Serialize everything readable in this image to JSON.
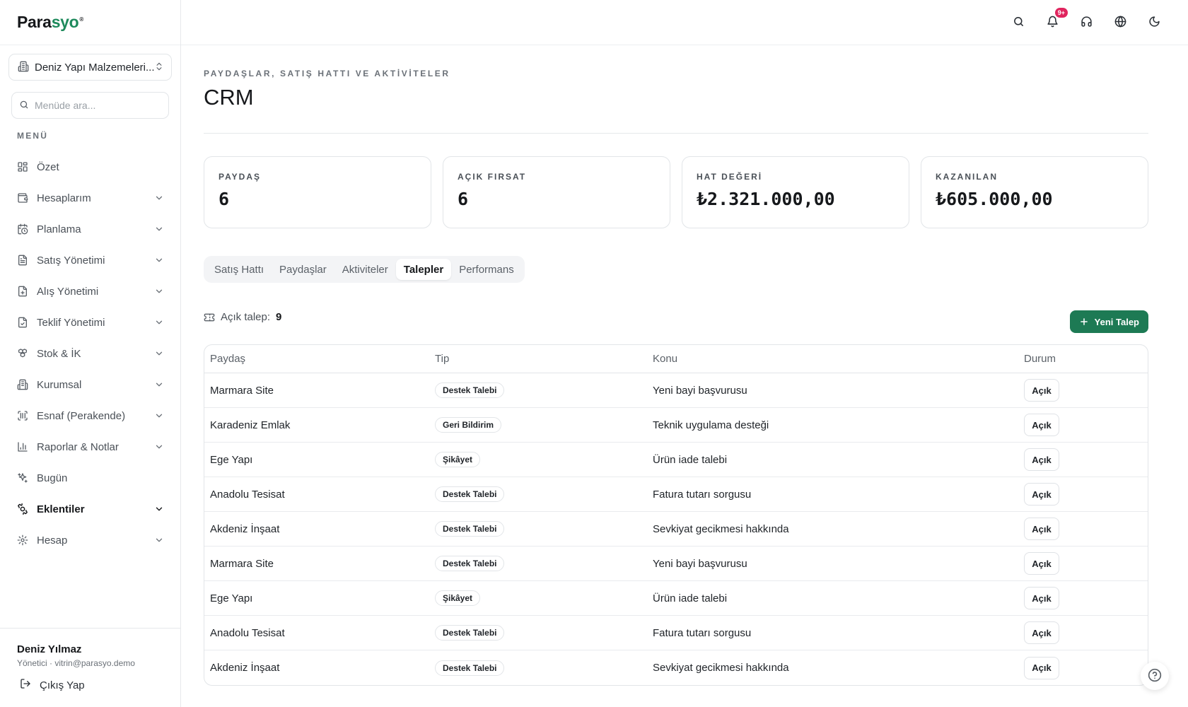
{
  "brand": {
    "name_dark": "Para",
    "name_accent": "syo",
    "mark": "®"
  },
  "company_selector": {
    "label": "Deniz Yapı Malzemeleri..."
  },
  "menu_search": {
    "placeholder": "Menüde ara..."
  },
  "menu_heading": "MENÜ",
  "nav": [
    {
      "label": "Özet",
      "icon": "dashboard-grid-icon",
      "has_chevron": false
    },
    {
      "label": "Hesaplarım",
      "icon": "wallet-icon",
      "has_chevron": true
    },
    {
      "label": "Planlama",
      "icon": "calendar-clock-icon",
      "has_chevron": true
    },
    {
      "label": "Satış Yönetimi",
      "icon": "receipt-icon",
      "has_chevron": true
    },
    {
      "label": "Alış Yönetimi",
      "icon": "file-plus-icon",
      "has_chevron": true
    },
    {
      "label": "Teklif Yönetimi",
      "icon": "file-check-icon",
      "has_chevron": true
    },
    {
      "label": "Stok & İK",
      "icon": "boxes-icon",
      "has_chevron": true
    },
    {
      "label": "Kurumsal",
      "icon": "building-icon",
      "has_chevron": true
    },
    {
      "label": "Esnaf (Perakende)",
      "icon": "scan-barcode-icon",
      "has_chevron": true
    },
    {
      "label": "Raporlar & Notlar",
      "icon": "bar-chart-icon",
      "has_chevron": true
    },
    {
      "label": "Bugün",
      "icon": "sparkles-icon",
      "has_chevron": false
    },
    {
      "label": "Eklentiler",
      "icon": "puzzle-icon",
      "has_chevron": true,
      "active": true
    },
    {
      "label": "Hesap",
      "icon": "settings-icon",
      "has_chevron": true
    }
  ],
  "user": {
    "name": "Deniz Yılmaz",
    "role": "Yönetici · vitrin@parasyo.demo",
    "logout_label": "Çıkış Yap"
  },
  "topbar": {
    "notification_badge": "9+",
    "icons": [
      "search-icon",
      "bell-icon",
      "headset-icon",
      "globe-icon",
      "moon-icon"
    ]
  },
  "page": {
    "eyebrow": "PAYDAŞLAR, SATIŞ HATTI VE AKTİVİTELER",
    "title": "CRM"
  },
  "stats": [
    {
      "label": "PAYDAŞ",
      "value": "6"
    },
    {
      "label": "AÇIK FIRSAT",
      "value": "6"
    },
    {
      "label": "HAT DEĞERİ",
      "value": "₺2.321.000,00"
    },
    {
      "label": "KAZANILAN",
      "value": "₺605.000,00"
    }
  ],
  "tabs": [
    {
      "label": "Satış Hattı"
    },
    {
      "label": "Paydaşlar"
    },
    {
      "label": "Aktiviteler"
    },
    {
      "label": "Talepler",
      "active": true
    },
    {
      "label": "Performans"
    }
  ],
  "open_requests": {
    "label": "Açık talep:",
    "count": "9"
  },
  "new_request_button": "Yeni Talep",
  "table": {
    "columns": [
      "Paydaş",
      "Tip",
      "Konu",
      "Durum"
    ],
    "rows": [
      {
        "stakeholder": "Marmara Site",
        "type": "Destek Talebi",
        "subject": "Yeni bayi başvurusu",
        "status": "Açık"
      },
      {
        "stakeholder": "Karadeniz Emlak",
        "type": "Geri Bildirim",
        "subject": "Teknik uygulama desteği",
        "status": "Açık"
      },
      {
        "stakeholder": "Ege Yapı",
        "type": "Şikâyet",
        "subject": "Ürün iade talebi",
        "status": "Açık"
      },
      {
        "stakeholder": "Anadolu Tesisat",
        "type": "Destek Talebi",
        "subject": "Fatura tutarı sorgusu",
        "status": "Açık"
      },
      {
        "stakeholder": "Akdeniz İnşaat",
        "type": "Destek Talebi",
        "subject": "Sevkiyat gecikmesi hakkında",
        "status": "Açık"
      },
      {
        "stakeholder": "Marmara Site",
        "type": "Destek Talebi",
        "subject": "Yeni bayi başvurusu",
        "status": "Açık"
      },
      {
        "stakeholder": "Ege Yapı",
        "type": "Şikâyet",
        "subject": "Ürün iade talebi",
        "status": "Açık"
      },
      {
        "stakeholder": "Anadolu Tesisat",
        "type": "Destek Talebi",
        "subject": "Fatura tutarı sorgusu",
        "status": "Açık"
      },
      {
        "stakeholder": "Akdeniz İnşaat",
        "type": "Destek Talebi",
        "subject": "Sevkiyat gecikmesi hakkında",
        "status": "Açık"
      }
    ]
  },
  "colors": {
    "accent": "#1d7a54",
    "badge": "#e0245e",
    "border": "#e2e5e8"
  }
}
